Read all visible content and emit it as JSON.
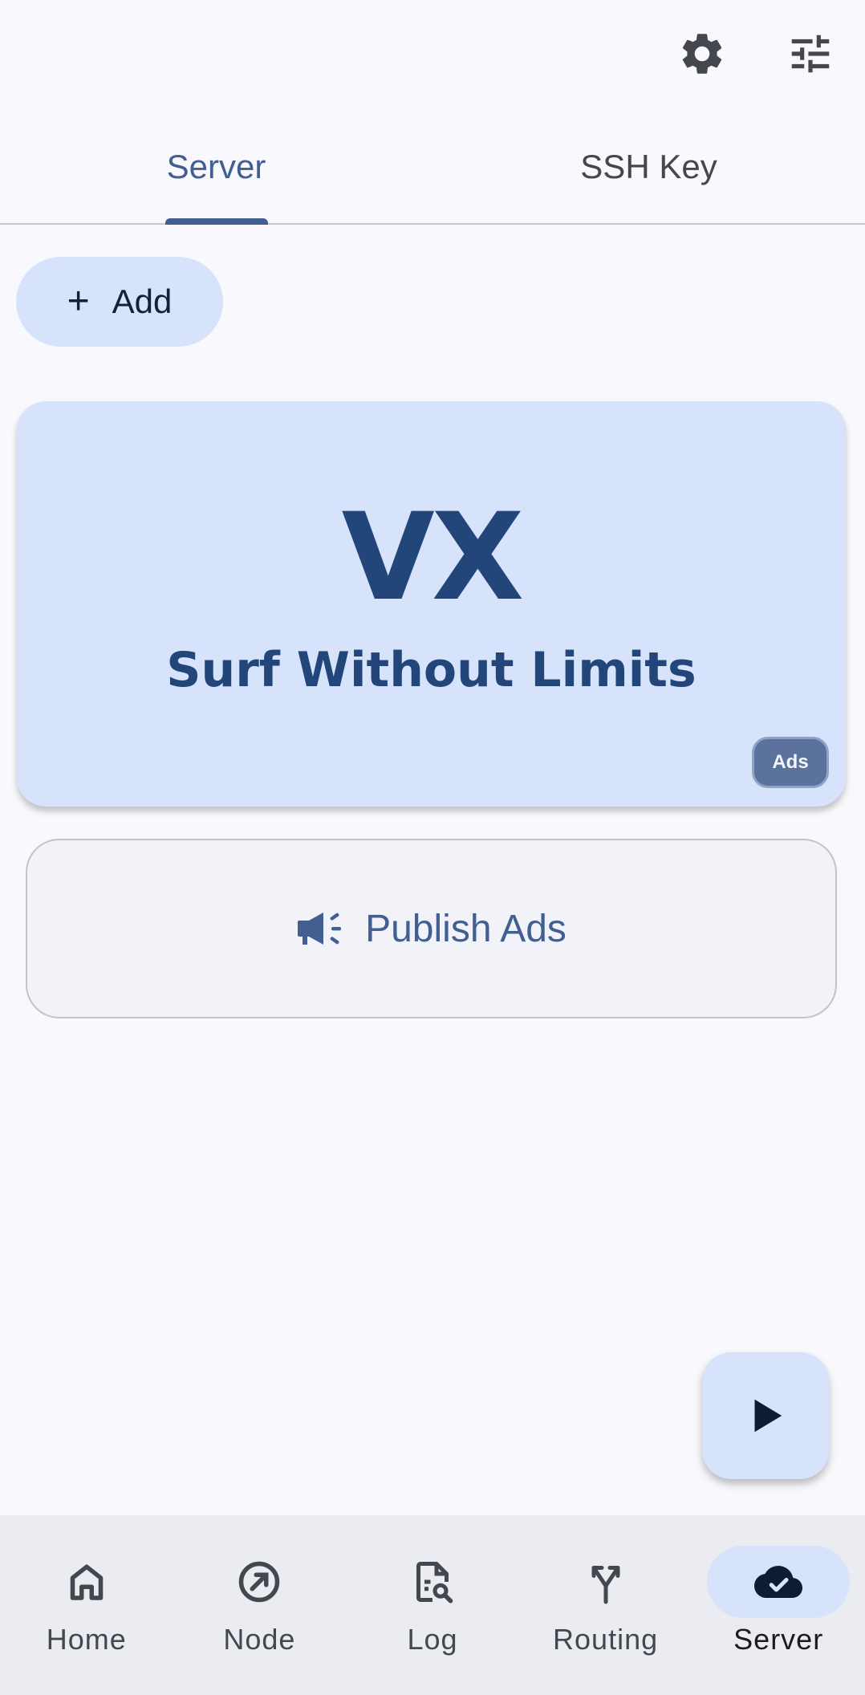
{
  "topbar": {
    "settings_icon": "gear-icon",
    "filter_icon": "tune-icon"
  },
  "tabs": [
    {
      "label": "Server",
      "active": true
    },
    {
      "label": "SSH Key",
      "active": false
    }
  ],
  "add_button": {
    "label": "Add",
    "icon": "plus-icon"
  },
  "ad": {
    "logo_text": "VX",
    "slogan": "Surf Without Limits",
    "badge": "Ads"
  },
  "publish": {
    "label": "Publish Ads",
    "icon": "campaign-icon"
  },
  "fab": {
    "icon": "play-icon"
  },
  "bottom_nav": [
    {
      "label": "Home",
      "icon": "home-icon",
      "active": false
    },
    {
      "label": "Node",
      "icon": "explore-icon",
      "active": false
    },
    {
      "label": "Log",
      "icon": "log-search-icon",
      "active": false
    },
    {
      "label": "Routing",
      "icon": "fork-icon",
      "active": false
    },
    {
      "label": "Server",
      "icon": "cloud-done-icon",
      "active": true
    }
  ],
  "colors": {
    "accent": "#415f91",
    "container": "#d6e3fb",
    "ad_text": "#23467a",
    "background": "#f8f8fd"
  }
}
